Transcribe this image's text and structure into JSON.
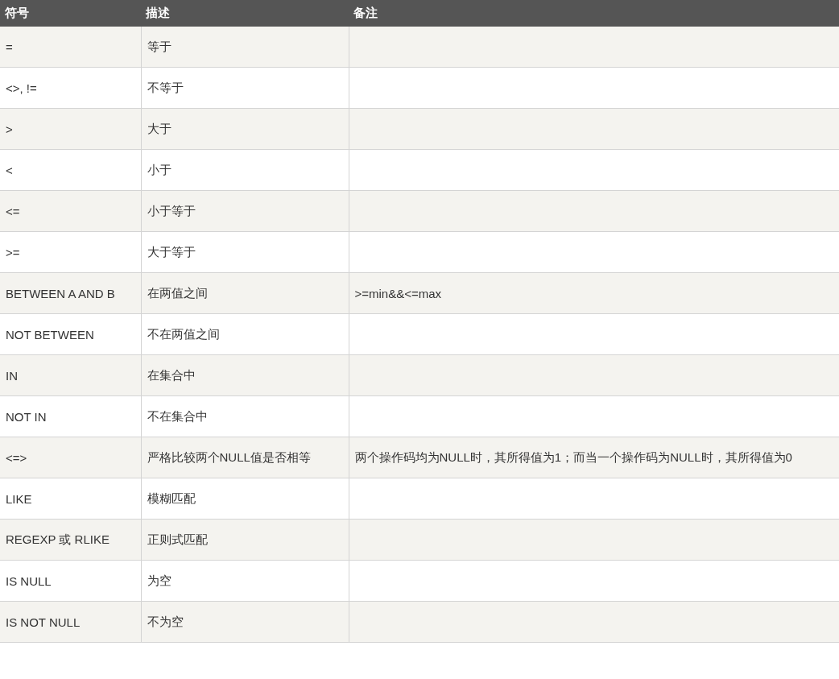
{
  "table": {
    "columns": [
      "符号",
      "描述",
      "备注"
    ],
    "rows": [
      [
        "=",
        "等于",
        ""
      ],
      [
        "<>, !=",
        "不等于",
        ""
      ],
      [
        ">",
        "大于",
        ""
      ],
      [
        "<",
        "小于",
        ""
      ],
      [
        "<=",
        "小于等于",
        ""
      ],
      [
        ">=",
        "大于等于",
        ""
      ],
      [
        "BETWEEN A AND B",
        "在两值之间",
        ">=min&&<=max"
      ],
      [
        "NOT BETWEEN",
        "不在两值之间",
        ""
      ],
      [
        "IN",
        "在集合中",
        ""
      ],
      [
        "NOT IN",
        "不在集合中",
        ""
      ],
      [
        "<=>",
        "严格比较两个NULL值是否相等",
        "两个操作码均为NULL时，其所得值为1；而当一个操作码为NULL时，其所得值为0"
      ],
      [
        "LIKE",
        "模糊匹配",
        ""
      ],
      [
        "REGEXP 或 RLIKE",
        "正则式匹配",
        ""
      ],
      [
        "IS NULL",
        "为空",
        ""
      ],
      [
        "IS NOT NULL",
        "不为空",
        ""
      ]
    ]
  }
}
